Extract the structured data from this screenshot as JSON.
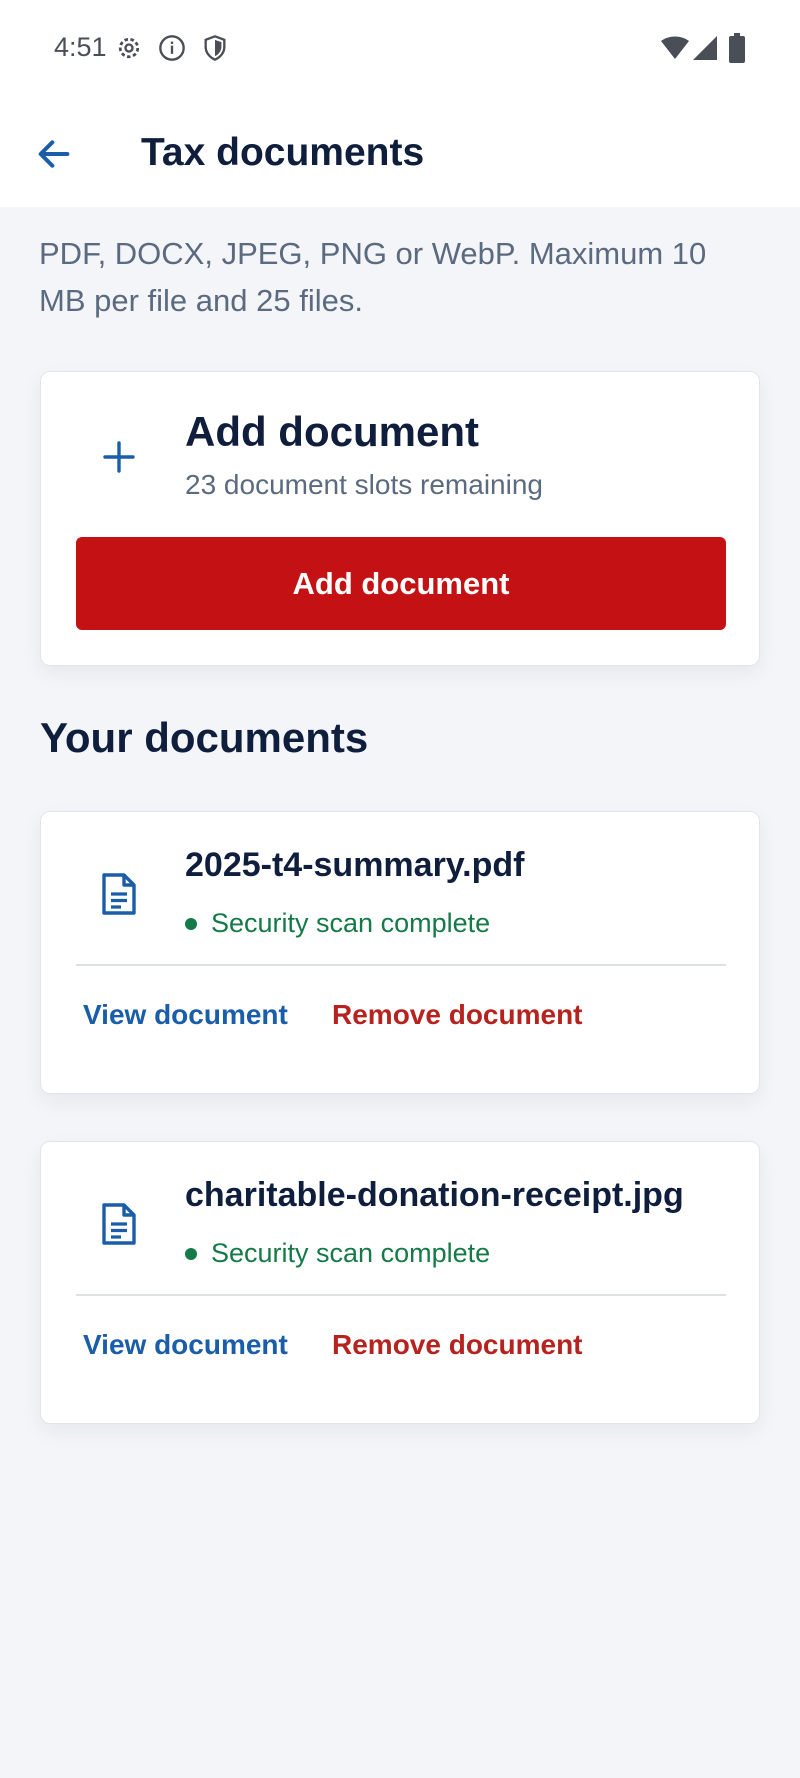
{
  "status_bar": {
    "time": "4:51",
    "left_icons": [
      "gear-icon",
      "info-icon",
      "shield-icon"
    ],
    "right_icons": [
      "wifi-icon",
      "signal-icon",
      "battery-icon"
    ]
  },
  "app_bar": {
    "title": "Tax documents",
    "back_icon": "arrow-left-icon"
  },
  "intro_text": "PDF, DOCX, JPEG, PNG or WebP. Maximum 10 MB per file and 25 files.",
  "add_card": {
    "icon": "plus-icon",
    "title": "Add document",
    "subtitle": "23 document slots remaining",
    "button_label": "Add document"
  },
  "documents_section": {
    "title": "Your documents",
    "items": [
      {
        "icon": "document-icon",
        "name": "2025-t4-summary.pdf",
        "status": "Security scan complete",
        "view_label": "View document",
        "remove_label": "Remove document"
      },
      {
        "icon": "document-icon",
        "name": "charitable-donation-receipt.jpg",
        "status": "Security scan complete",
        "view_label": "View document",
        "remove_label": "Remove document"
      }
    ]
  },
  "colors": {
    "primary_blue": "#1a5da8",
    "danger_red": "#c41214",
    "success_green": "#157a47",
    "heading": "#0f1e3d",
    "muted_text": "#5c6a80",
    "background": "#f3f5f8"
  }
}
